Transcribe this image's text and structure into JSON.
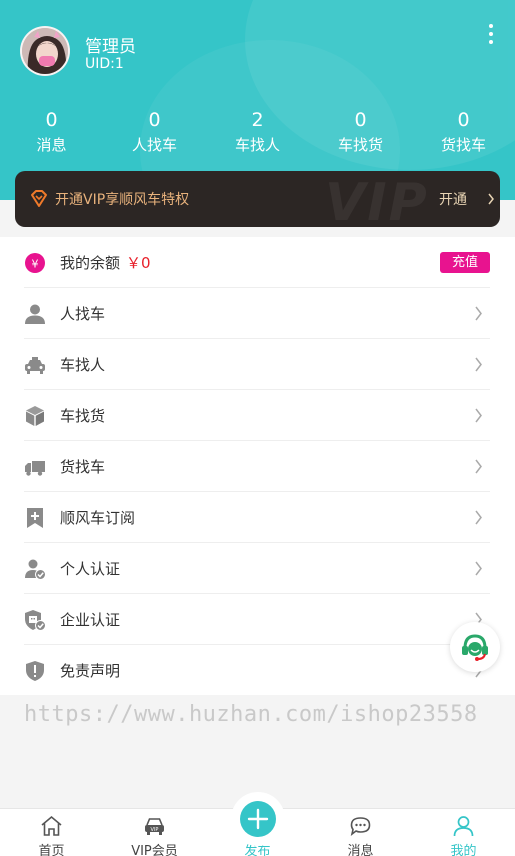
{
  "user": {
    "name": "管理员",
    "uid": "UID:1"
  },
  "stats": [
    {
      "value": "0",
      "label": "消息"
    },
    {
      "value": "0",
      "label": "人找车"
    },
    {
      "value": "2",
      "label": "车找人"
    },
    {
      "value": "0",
      "label": "车找货"
    },
    {
      "value": "0",
      "label": "货找车"
    }
  ],
  "vip": {
    "text": "开通VIP享顺风车特权",
    "button": "开通",
    "watermark": "VIP"
  },
  "balance": {
    "label": "我的余额",
    "value": "￥0",
    "button": "充值"
  },
  "menu": [
    {
      "label": "人找车",
      "icon": "person-icon"
    },
    {
      "label": "车找人",
      "icon": "taxi-icon"
    },
    {
      "label": "车找货",
      "icon": "cargo-box-icon"
    },
    {
      "label": "货找车",
      "icon": "truck-icon"
    },
    {
      "label": "顺风车订阅",
      "icon": "subscribe-bookmark-icon"
    },
    {
      "label": "个人认证",
      "icon": "personal-verify-icon"
    },
    {
      "label": "企业认证",
      "icon": "enterprise-verify-icon"
    },
    {
      "label": "免责声明",
      "icon": "disclaimer-shield-icon"
    }
  ],
  "watermark": "https://www.huzhan.com/ishop23558",
  "tabs": [
    {
      "label": "首页",
      "icon": "home-icon"
    },
    {
      "label": "VIP会员",
      "icon": "vip-car-icon"
    },
    {
      "label": "发布",
      "icon": "plus-icon"
    },
    {
      "label": "消息",
      "icon": "chat-bubble-icon"
    },
    {
      "label": "我的",
      "icon": "user-icon"
    }
  ],
  "colors": {
    "primary": "#35c5c8",
    "vip_bg": "#2c2624",
    "vip_gold": "#e8b27c",
    "recharge": "#e8138f",
    "price_red": "#e8202a"
  }
}
